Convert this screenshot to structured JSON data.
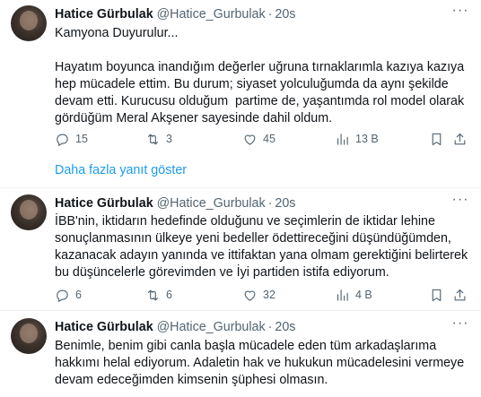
{
  "tweets": [
    {
      "name": "Hatice Gürbulak",
      "handle": "@Hatice_Gurbulak",
      "time": "20s",
      "body": "Kamyona Duyurulur...\n\nHayatım boyunca inandığım değerler uğruna tırnaklarımla kazıya kazıya\nhep mücadele ettim. Bu durum; siyaset yolculuğumda da aynı şekilde\ndevam etti. Kurucusu olduğum  partime de, yaşantımda rol model olarak\ngördüğüm Meral Akşener sayesinde dahil oldum.",
      "replies": "15",
      "retweets": "3",
      "likes": "45",
      "views": "13 B"
    },
    {
      "name": "Hatice Gürbulak",
      "handle": "@Hatice_Gurbulak",
      "time": "20s",
      "body": "İBB'nin, iktidarın hedefinde olduğunu ve seçimlerin de iktidar lehine\nsonuçlanmasının ülkeye yeni bedeller ödettireceğini düşündüğümden,\nkazanacak adayın yanında ve ittifaktan yana olmam gerektiğini belirterek\nbu düşüncelerle görevimden ve İyi partiden istifa ediyorum.",
      "replies": "6",
      "retweets": "6",
      "likes": "32",
      "views": "4 B"
    },
    {
      "name": "Hatice Gürbulak",
      "handle": "@Hatice_Gurbulak",
      "time": "20s",
      "body": "Benimle, benim gibi canla başla mücadele eden tüm arkadaşlarıma\nhakkımı helal ediyorum. Adaletin hak ve hukukun mücadelesini vermeye\ndevam edeceğimden kimsenin şüphesi olmasın."
    }
  ],
  "show_more_label": "Daha fazla yanıt göster",
  "dot": "·",
  "more_glyph": "···",
  "colors": {
    "link": "#1d9bf0",
    "secondary": "#536471",
    "text": "#0f1419"
  },
  "icons": [
    "reply-icon",
    "retweet-icon",
    "like-icon",
    "views-icon",
    "bookmark-icon",
    "share-icon",
    "more-icon"
  ]
}
